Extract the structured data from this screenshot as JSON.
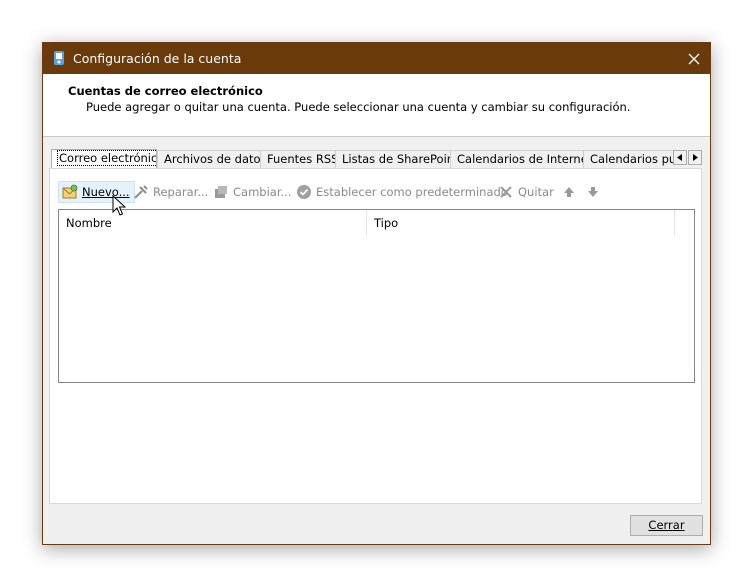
{
  "window": {
    "title": "Configuración de la cuenta"
  },
  "header": {
    "title": "Cuentas de correo electrónico",
    "description": "Puede agregar o quitar una cuenta. Puede seleccionar una cuenta y cambiar su configuración."
  },
  "tabs": [
    {
      "label": "Correo electrónico",
      "active": true
    },
    {
      "label": "Archivos de datos",
      "active": false
    },
    {
      "label": "Fuentes RSS",
      "active": false
    },
    {
      "label": "Listas de SharePoint",
      "active": false
    },
    {
      "label": "Calendarios de Internet",
      "active": false
    },
    {
      "label": "Calendarios pul",
      "active": false
    }
  ],
  "toolbar": {
    "new_label": "Nuevo...",
    "repair_label": "Reparar...",
    "change_label": "Cambiar...",
    "set_default_label": "Establecer como predeterminado",
    "remove_label": "Quitar"
  },
  "list": {
    "columns": [
      "Nombre",
      "Tipo"
    ],
    "rows": []
  },
  "footer": {
    "close_label": "Cerrar"
  },
  "icons": {
    "app": "outlook-settings-icon",
    "close": "close-icon",
    "new": "new-mail-account-icon",
    "repair": "repair-tools-icon",
    "change": "change-icon",
    "set_default": "checkmark-circle-icon",
    "remove": "x-icon",
    "move_up": "arrow-up-icon",
    "move_down": "arrow-down-icon"
  },
  "colors": {
    "titlebar": "#6b3a0a",
    "disabled_text": "#8a8a8a",
    "hover_bg": "#e5f1fb"
  }
}
